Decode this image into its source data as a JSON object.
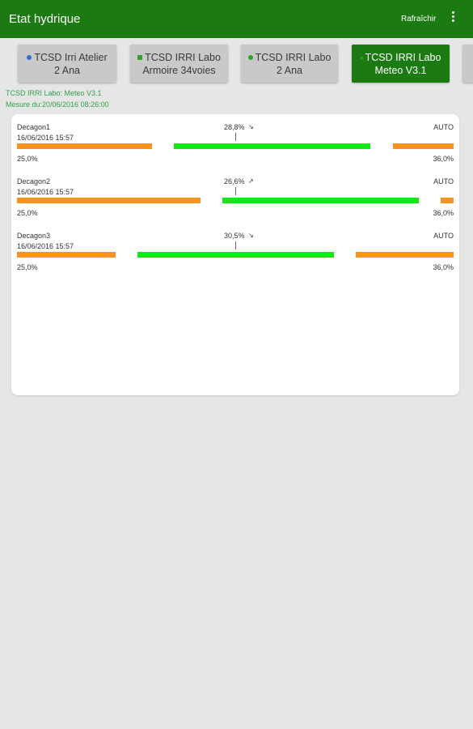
{
  "app": {
    "title": "Etat hydrique",
    "refresh_label": "Rafraîchir",
    "colors": {
      "primary": "#1b7a12",
      "range_low_high": "#f7931e",
      "range_ok": "#14e814"
    }
  },
  "tabs": [
    {
      "line1": "TCSD Irri Atelier",
      "line2": "2 Ana",
      "icon": "blue-dot-icon",
      "icon_color": "#2f6fcf",
      "active": false
    },
    {
      "line1": "TCSD IRRI Labo",
      "line2": "Armoire 34voies",
      "icon": "green-square-icon",
      "icon_color": "#2aa52a",
      "active": false
    },
    {
      "line1": "TCSD IRRI Labo",
      "line2": "2 Ana",
      "icon": "green-dot-icon",
      "icon_color": "#2aa52a",
      "active": false
    },
    {
      "line1": "TCSD IRRI Labo",
      "line2": "Meteo V3.1",
      "icon": "green-dot-icon",
      "icon_color": "#2aa52a",
      "active": true
    }
  ],
  "station": {
    "name": "TCSD IRRI Labo: Meteo V3.1",
    "measure": "Mesure du:20/06/2016 08:26:00"
  },
  "sensors": [
    {
      "name": "Decagon1",
      "date": "16/06/2016 15:57",
      "value": "28,8%",
      "trend": "↘",
      "mode": "AUTO",
      "min": "25,0%",
      "max": "36,0%"
    },
    {
      "name": "Decagon2",
      "date": "16/06/2016 15:57",
      "value": "26,6%",
      "trend": "↗",
      "mode": "AUTO",
      "min": "25,0%",
      "max": "36,0%"
    },
    {
      "name": "Decagon3",
      "date": "16/06/2016 15:57",
      "value": "30,5%",
      "trend": "↘",
      "mode": "AUTO",
      "min": "25,0%",
      "max": "36,0%"
    }
  ]
}
